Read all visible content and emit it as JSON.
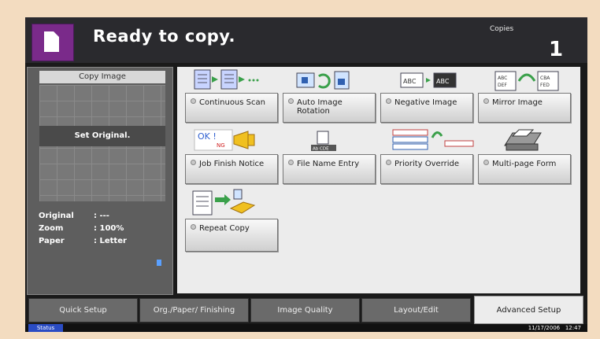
{
  "header": {
    "status": "Ready to copy.",
    "copies_label": "Copies",
    "copies_value": "1",
    "icon": "copy-document-icon"
  },
  "preview": {
    "title": "Copy Image",
    "message": "Set Original.",
    "info": [
      {
        "key": "Original",
        "value": ": ---"
      },
      {
        "key": "Zoom",
        "value": ": 100%"
      },
      {
        "key": "Paper",
        "value": ": Letter"
      }
    ]
  },
  "functions": [
    {
      "label": "Continuous Scan",
      "icon": "continuous-scan-icon"
    },
    {
      "label": "Auto Image Rotation",
      "icon": "auto-rotation-icon"
    },
    {
      "label": "Negative Image",
      "icon": "negative-image-icon",
      "icon_text_a": "ABC",
      "icon_text_b": "ABC"
    },
    {
      "label": "Mirror Image",
      "icon": "mirror-image-icon",
      "icon_text_a": "ABC DEF",
      "icon_text_b": "CBA FED"
    },
    {
      "label": "Job Finish Notice",
      "icon": "job-finish-icon",
      "icon_text_a": "OK !",
      "icon_text_b": "NG"
    },
    {
      "label": "File Name Entry",
      "icon": "file-name-icon",
      "icon_text_a": "Ab CDE"
    },
    {
      "label": "Priority Override",
      "icon": "priority-override-icon"
    },
    {
      "label": "Multi-page Form",
      "icon": "multi-page-form-icon"
    },
    {
      "label": "Repeat Copy",
      "icon": "repeat-copy-icon"
    }
  ],
  "tabs": [
    {
      "label": "Quick Setup"
    },
    {
      "label": "Org./Paper/ Finishing"
    },
    {
      "label": "Image Quality"
    },
    {
      "label": "Layout/Edit"
    },
    {
      "label": "Advanced Setup",
      "active": true
    }
  ],
  "statusbar": {
    "button": "Status",
    "date": "11/17/2006",
    "time": "12:47"
  },
  "colors": {
    "accent_purple": "#7a2a8a",
    "status_blue": "#2a4cc4",
    "yellow_accent": "#f0c020",
    "green_arrow": "#3aa04a"
  }
}
